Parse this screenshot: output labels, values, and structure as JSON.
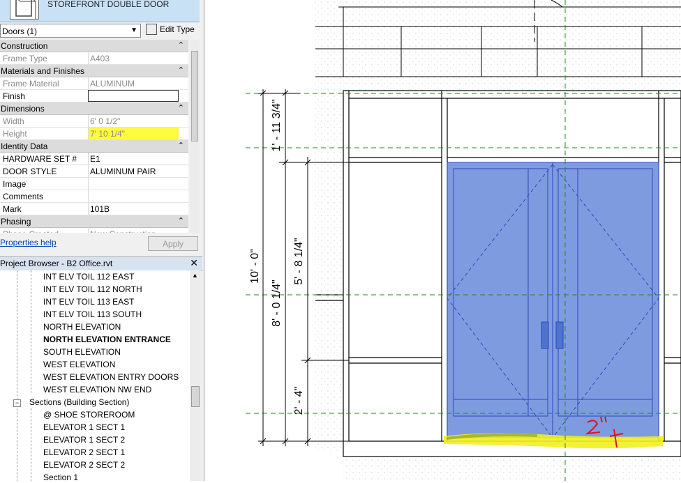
{
  "properties": {
    "type_name": "STOREFRONT DOUBLE DOOR",
    "selector": "Doors (1)",
    "edit_type": "Edit Type",
    "groups": [
      {
        "label": "Construction",
        "collapse": "⌃",
        "rows": [
          {
            "name": "Frame Type",
            "value": "A403",
            "disabled": true
          }
        ]
      },
      {
        "label": "Materials and Finishes",
        "collapse": "⌃",
        "rows": [
          {
            "name": "Frame Material",
            "value": "ALUMINUM",
            "disabled": true
          },
          {
            "name": "Finish",
            "value": "",
            "editing": true
          }
        ]
      },
      {
        "label": "Dimensions",
        "collapse": "⌃",
        "rows": [
          {
            "name": "Width",
            "value": "6'  0 1/2\"",
            "disabled": true
          },
          {
            "name": "Height",
            "value": "7'  10 1/4\"",
            "disabled": true,
            "highlight": true
          }
        ]
      },
      {
        "label": "Identity Data",
        "collapse": "⌃",
        "rows": [
          {
            "name": "HARDWARE SET #",
            "value": "E1"
          },
          {
            "name": "DOOR STYLE",
            "value": "ALUMINUM PAIR"
          },
          {
            "name": "Image",
            "value": ""
          },
          {
            "name": "Comments",
            "value": ""
          },
          {
            "name": "Mark",
            "value": "101B"
          }
        ]
      },
      {
        "label": "Phasing",
        "collapse": "⌃",
        "rows": [
          {
            "name": "Phase Created",
            "value": "New Construction",
            "disabled": true
          }
        ]
      }
    ],
    "help_link": "Properties help",
    "apply_button": "Apply"
  },
  "project_browser": {
    "title": "Project Browser - B2 Office.rvt",
    "close": "✕",
    "items": [
      {
        "label": "INT ELV TOIL 112 EAST",
        "level": 2
      },
      {
        "label": "INT ELV TOIL 112 NORTH",
        "level": 2
      },
      {
        "label": "INT ELV TOIL 113 EAST",
        "level": 2
      },
      {
        "label": "INT ELV TOIL 113 SOUTH",
        "level": 2
      },
      {
        "label": "NORTH ELEVATION",
        "level": 2
      },
      {
        "label": "NORTH ELEVATION ENTRANCE",
        "level": 2,
        "bold": true
      },
      {
        "label": "SOUTH ELEVATION",
        "level": 2
      },
      {
        "label": "WEST ELEVATION",
        "level": 2
      },
      {
        "label": "WEST ELEVATION ENTRY DOORS",
        "level": 2
      },
      {
        "label": "WEST ELEVATION NW END",
        "level": 2
      },
      {
        "label": "Sections (Building Section)",
        "level": 1,
        "expander": "−"
      },
      {
        "label": "@ SHOE STOREROOM",
        "level": 2
      },
      {
        "label": "ELEVATOR 1 SECT 1",
        "level": 2
      },
      {
        "label": "ELEVATOR 1 SECT 2",
        "level": 2
      },
      {
        "label": "ELEVATOR 2 SECT 1",
        "level": 2
      },
      {
        "label": "ELEVATOR 2 SECT 2",
        "level": 2
      },
      {
        "label": "Section 1",
        "level": 2
      }
    ]
  },
  "drawing": {
    "dimensions": [
      "10' - 0\"",
      "1' - 11 3/4\"",
      "5' - 8 1/4\"",
      "8' - 0 1/4\"",
      "2' - 4\""
    ],
    "markup": "2\"",
    "colors": {
      "door_fill": "#7f9be0",
      "door_stroke": "#2a4ab8",
      "gridline": "#1f8a1f",
      "highlight": "#f2f01e",
      "markup": "#e0101a"
    }
  }
}
